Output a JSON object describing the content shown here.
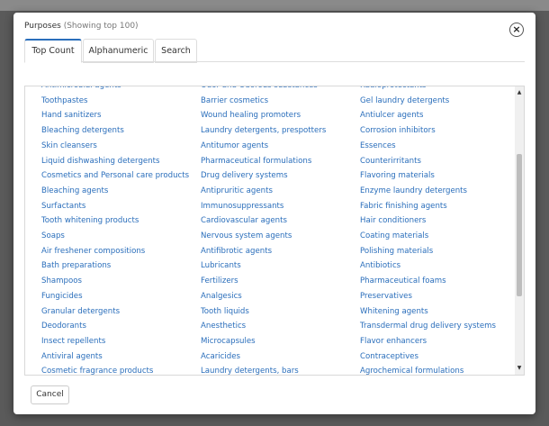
{
  "modal": {
    "title": "Purposes",
    "subtitle": "(Showing top 100)",
    "close_symbol": "×"
  },
  "tabs": [
    {
      "label": "Top Count",
      "active": true
    },
    {
      "label": "Alphanumeric",
      "active": false
    },
    {
      "label": "Search",
      "active": false
    }
  ],
  "columns": [
    [
      "Antimicrobial agents",
      "Toothpastes",
      "Hand sanitizers",
      "Bleaching detergents",
      "Skin cleansers",
      "Liquid dishwashing detergents",
      "Cosmetics and Personal care products",
      "Bleaching agents",
      "Surfactants",
      "Tooth whitening products",
      "Soaps",
      "Air freshener compositions",
      "Bath preparations",
      "Shampoos",
      "Fungicides",
      "Granular detergents",
      "Deodorants",
      "Insect repellents",
      "Antiviral agents",
      "Cosmetic fragrance products"
    ],
    [
      "Odor and Odorous substances",
      "Barrier cosmetics",
      "Wound healing promoters",
      "Laundry detergents, prespotters",
      "Antitumor agents",
      "Pharmaceutical formulations",
      "Drug delivery systems",
      "Antipruritic agents",
      "Immunosuppressants",
      "Cardiovascular agents",
      "Nervous system agents",
      "Antifibrotic agents",
      "Lubricants",
      "Fertilizers",
      "Analgesics",
      "Tooth liquids",
      "Anesthetics",
      "Microcapsules",
      "Acaricides",
      "Laundry detergents, bars"
    ],
    [
      "Radioprotectants",
      "Gel laundry detergents",
      "Antiulcer agents",
      "Corrosion inhibitors",
      "Essences",
      "Counterirritants",
      "Flavoring materials",
      "Enzyme laundry detergents",
      "Fabric finishing agents",
      "Hair conditioners",
      "Coating materials",
      "Polishing materials",
      "Antibiotics",
      "Pharmaceutical foams",
      "Preservatives",
      "Whitening agents",
      "Transdermal drug delivery systems",
      "Flavor enhancers",
      "Contraceptives",
      "Agrochemical formulations"
    ]
  ],
  "footer": {
    "cancel_label": "Cancel"
  },
  "colors": {
    "link": "#2a6ebb",
    "active_tab_border": "#2a6ebb"
  }
}
